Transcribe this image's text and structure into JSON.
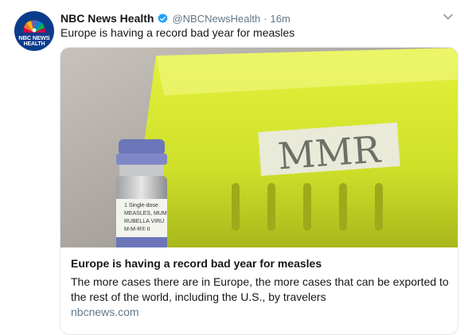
{
  "tweet": {
    "author_name": "NBC News Health",
    "handle": "@NBCNewsHealth",
    "separator": "·",
    "time": "16m",
    "text": "Europe is having a record bad year for measles"
  },
  "avatar": {
    "line1": "NBC NEWS",
    "line2": "HEALTH"
  },
  "card": {
    "image_label": "MMR",
    "vial_label_lines": [
      "1 Single-dose",
      "MEASLES, MUM",
      "RUBELLA VIRU",
      "M-M-R® II"
    ],
    "title": "Europe is having a record bad year for measles",
    "description": "The more cases there are in Europe, the more cases that can be exported to the rest of the world, including the U.S., by travelers",
    "domain": "nbcnews.com"
  },
  "colors": {
    "verified": "#1da1f2",
    "name": "#14171a",
    "muted": "#657786",
    "basket": "#d4e830",
    "avatar_bg": "#0b3c8c"
  },
  "icons": {
    "verified": "verified-badge-icon",
    "caret": "chevron-down-icon",
    "logo": "nbc-peacock-icon"
  }
}
